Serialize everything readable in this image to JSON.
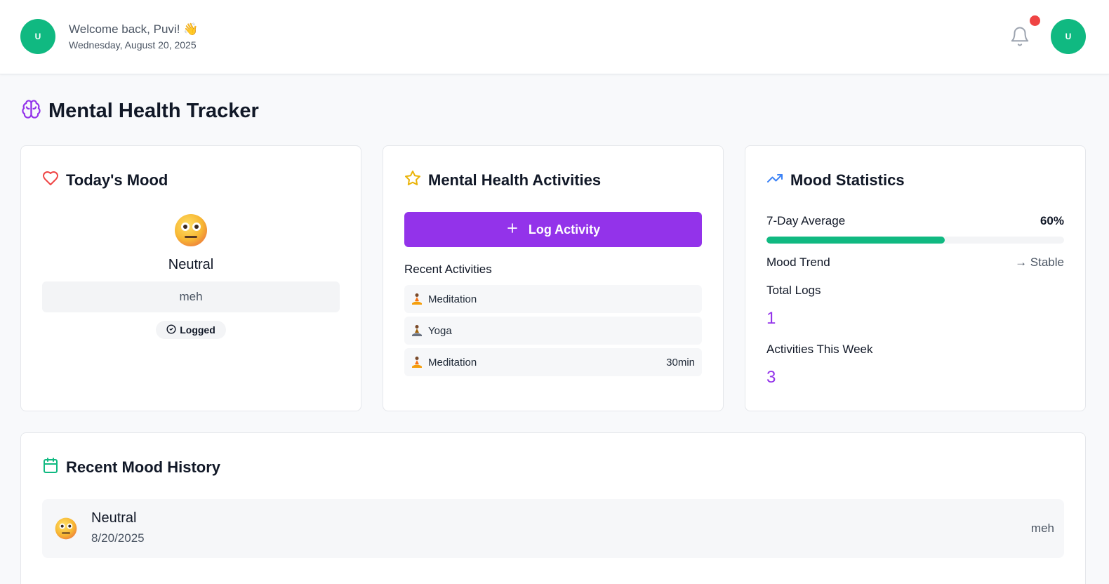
{
  "header": {
    "avatar_initial": "U",
    "welcome": "Welcome back, Puvi! 👋",
    "date": "Wednesday, August 20, 2025",
    "notification_indicator": true
  },
  "page": {
    "title": "Mental Health Tracker"
  },
  "todays_mood": {
    "title": "Today's Mood",
    "mood": "Neutral",
    "note": "meh",
    "status": "Logged"
  },
  "activities": {
    "title": "Mental Health Activities",
    "log_button": "Log Activity",
    "recent_heading": "Recent Activities",
    "items": [
      {
        "name": "Meditation",
        "duration": ""
      },
      {
        "name": "Yoga",
        "duration": ""
      },
      {
        "name": "Meditation",
        "duration": "30min"
      }
    ]
  },
  "stats": {
    "title": "Mood Statistics",
    "avg_label": "7-Day Average",
    "avg_value": "60%",
    "avg_fraction": 0.6,
    "trend_label": "Mood Trend",
    "trend_value": "→ Stable",
    "total_logs_label": "Total Logs",
    "total_logs": "1",
    "activities_week_label": "Activities This Week",
    "activities_week": "3"
  },
  "history": {
    "title": "Recent Mood History",
    "entries": [
      {
        "mood": "Neutral",
        "date": "8/20/2025",
        "note": "meh"
      }
    ]
  },
  "colors": {
    "accent_purple": "#9333ea",
    "success_green": "#10b981",
    "alert_red": "#ef4444",
    "heart_red": "#ef4444",
    "star_amber": "#eab308",
    "trend_blue": "#3b82f6"
  },
  "icons": [
    "brain-icon",
    "heart-icon",
    "star-icon",
    "trending-up-icon",
    "calendar-icon",
    "bell-icon",
    "plus-icon",
    "check-circle-icon",
    "meditation-icon",
    "neutral-face-icon"
  ]
}
